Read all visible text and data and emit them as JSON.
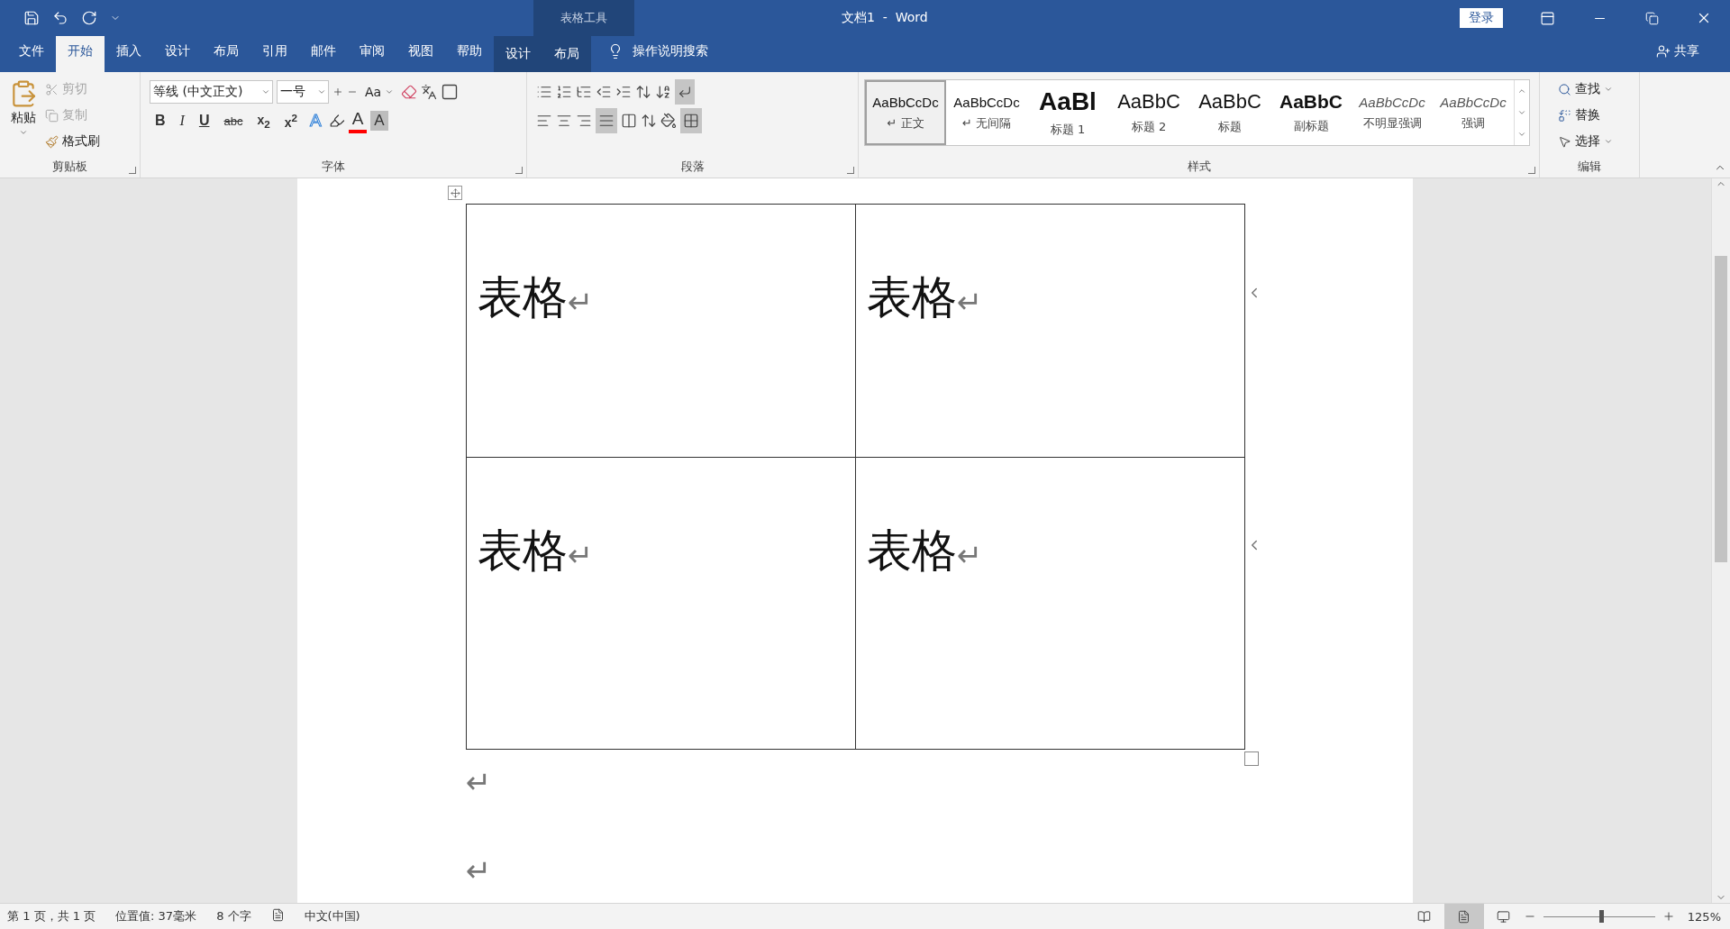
{
  "title_bar": {
    "context_label": "表格工具",
    "title": "文档1  -  Word",
    "login": "登录"
  },
  "tabs": [
    {
      "label": "文件",
      "selected": false,
      "kind": "main"
    },
    {
      "label": "开始",
      "selected": true,
      "kind": "main"
    },
    {
      "label": "插入",
      "selected": false,
      "kind": "main"
    },
    {
      "label": "设计",
      "selected": false,
      "kind": "main"
    },
    {
      "label": "布局",
      "selected": false,
      "kind": "main"
    },
    {
      "label": "引用",
      "selected": false,
      "kind": "main"
    },
    {
      "label": "邮件",
      "selected": false,
      "kind": "main"
    },
    {
      "label": "审阅",
      "selected": false,
      "kind": "main"
    },
    {
      "label": "视图",
      "selected": false,
      "kind": "main"
    },
    {
      "label": "帮助",
      "selected": false,
      "kind": "main"
    },
    {
      "label": "设计",
      "selected": false,
      "kind": "context"
    },
    {
      "label": "布局",
      "selected": false,
      "kind": "context"
    }
  ],
  "tell_me": "操作说明搜索",
  "share": "共享",
  "clipboard": {
    "paste": "粘贴",
    "cut": {
      "label": "剪切",
      "disabled": true
    },
    "copy": {
      "label": "复制",
      "disabled": true
    },
    "format_painter": {
      "label": "格式刷",
      "disabled": false
    },
    "group_label": "剪贴板"
  },
  "font": {
    "font_name": "等线 (中文正文)",
    "font_size": "一号",
    "case_button": "Aa",
    "format_buttons": [
      {
        "label": "B",
        "kind": "bold"
      },
      {
        "label": "I",
        "kind": "italic"
      },
      {
        "label": "U",
        "kind": "underline"
      },
      {
        "label": "abc",
        "kind": "strike"
      },
      {
        "label": "x$_{2}$",
        "kind": "plain"
      },
      {
        "label": "x$^{2}$",
        "kind": "plain"
      }
    ],
    "effect_buttons": [
      {
        "label": "A",
        "kind": "effect"
      },
      {
        "label": "A",
        "kind": "color",
        "color": "#ff0000"
      },
      {
        "label": "A",
        "kind": "shade"
      }
    ],
    "group_label": "字体"
  },
  "paragraph": {
    "group_label": "段落"
  },
  "styles": {
    "items": [
      {
        "preview": "AaBbCcDc",
        "name": "正文",
        "mark": "↵",
        "kind": "normal",
        "selected": true
      },
      {
        "preview": "AaBbCcDc",
        "name": "无间隔",
        "mark": "↵",
        "kind": "normal",
        "selected": false
      },
      {
        "preview": "AaBl",
        "name": "标题 1",
        "kind": "heading1",
        "selected": false
      },
      {
        "preview": "AaBbC",
        "name": "标题 2",
        "kind": "heading2",
        "selected": false
      },
      {
        "preview": "AaBbC",
        "name": "标题",
        "kind": "title",
        "selected": false
      },
      {
        "preview": "AaBbC",
        "name": "副标题",
        "kind": "subtitle",
        "selected": false
      },
      {
        "preview": "AaBbCcDc",
        "name": "不明显强调",
        "kind": "subtle",
        "selected": false
      },
      {
        "preview": "AaBbCcDc",
        "name": "强调",
        "kind": "emphasis",
        "selected": false
      }
    ],
    "group_label": "样式"
  },
  "editing": {
    "find": "查找",
    "replace": "替换",
    "select": "选择",
    "group_label": "编辑"
  },
  "document": {
    "table": {
      "rows": [
        [
          {
            "text": "表格",
            "mark": "↵"
          },
          {
            "text": "表格",
            "mark": "↵"
          }
        ],
        [
          {
            "text": "表格",
            "mark": "↵"
          },
          {
            "text": "表格",
            "mark": "↵"
          }
        ]
      ]
    },
    "paragraph_marks": [
      "↵",
      "↵"
    ]
  },
  "status_bar": {
    "page": "第 1 页，共 1 页",
    "position": "位置值: 37毫米",
    "words": "8 个字",
    "language": "中文(中国)",
    "views": [
      {
        "selected": false
      },
      {
        "selected": true
      },
      {
        "selected": false
      }
    ],
    "zoom": {
      "level": 0.52,
      "reading": "125%"
    }
  }
}
